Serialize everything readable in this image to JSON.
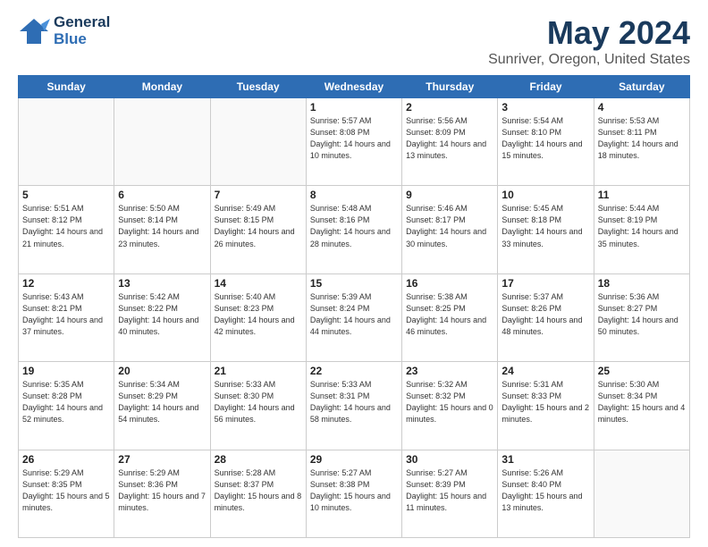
{
  "logo": {
    "line1": "General",
    "line2": "Blue"
  },
  "title": "May 2024",
  "subtitle": "Sunriver, Oregon, United States",
  "weekdays": [
    "Sunday",
    "Monday",
    "Tuesday",
    "Wednesday",
    "Thursday",
    "Friday",
    "Saturday"
  ],
  "weeks": [
    [
      {
        "day": "",
        "info": ""
      },
      {
        "day": "",
        "info": ""
      },
      {
        "day": "",
        "info": ""
      },
      {
        "day": "1",
        "info": "Sunrise: 5:57 AM\nSunset: 8:08 PM\nDaylight: 14 hours\nand 10 minutes."
      },
      {
        "day": "2",
        "info": "Sunrise: 5:56 AM\nSunset: 8:09 PM\nDaylight: 14 hours\nand 13 minutes."
      },
      {
        "day": "3",
        "info": "Sunrise: 5:54 AM\nSunset: 8:10 PM\nDaylight: 14 hours\nand 15 minutes."
      },
      {
        "day": "4",
        "info": "Sunrise: 5:53 AM\nSunset: 8:11 PM\nDaylight: 14 hours\nand 18 minutes."
      }
    ],
    [
      {
        "day": "5",
        "info": "Sunrise: 5:51 AM\nSunset: 8:12 PM\nDaylight: 14 hours\nand 21 minutes."
      },
      {
        "day": "6",
        "info": "Sunrise: 5:50 AM\nSunset: 8:14 PM\nDaylight: 14 hours\nand 23 minutes."
      },
      {
        "day": "7",
        "info": "Sunrise: 5:49 AM\nSunset: 8:15 PM\nDaylight: 14 hours\nand 26 minutes."
      },
      {
        "day": "8",
        "info": "Sunrise: 5:48 AM\nSunset: 8:16 PM\nDaylight: 14 hours\nand 28 minutes."
      },
      {
        "day": "9",
        "info": "Sunrise: 5:46 AM\nSunset: 8:17 PM\nDaylight: 14 hours\nand 30 minutes."
      },
      {
        "day": "10",
        "info": "Sunrise: 5:45 AM\nSunset: 8:18 PM\nDaylight: 14 hours\nand 33 minutes."
      },
      {
        "day": "11",
        "info": "Sunrise: 5:44 AM\nSunset: 8:19 PM\nDaylight: 14 hours\nand 35 minutes."
      }
    ],
    [
      {
        "day": "12",
        "info": "Sunrise: 5:43 AM\nSunset: 8:21 PM\nDaylight: 14 hours\nand 37 minutes."
      },
      {
        "day": "13",
        "info": "Sunrise: 5:42 AM\nSunset: 8:22 PM\nDaylight: 14 hours\nand 40 minutes."
      },
      {
        "day": "14",
        "info": "Sunrise: 5:40 AM\nSunset: 8:23 PM\nDaylight: 14 hours\nand 42 minutes."
      },
      {
        "day": "15",
        "info": "Sunrise: 5:39 AM\nSunset: 8:24 PM\nDaylight: 14 hours\nand 44 minutes."
      },
      {
        "day": "16",
        "info": "Sunrise: 5:38 AM\nSunset: 8:25 PM\nDaylight: 14 hours\nand 46 minutes."
      },
      {
        "day": "17",
        "info": "Sunrise: 5:37 AM\nSunset: 8:26 PM\nDaylight: 14 hours\nand 48 minutes."
      },
      {
        "day": "18",
        "info": "Sunrise: 5:36 AM\nSunset: 8:27 PM\nDaylight: 14 hours\nand 50 minutes."
      }
    ],
    [
      {
        "day": "19",
        "info": "Sunrise: 5:35 AM\nSunset: 8:28 PM\nDaylight: 14 hours\nand 52 minutes."
      },
      {
        "day": "20",
        "info": "Sunrise: 5:34 AM\nSunset: 8:29 PM\nDaylight: 14 hours\nand 54 minutes."
      },
      {
        "day": "21",
        "info": "Sunrise: 5:33 AM\nSunset: 8:30 PM\nDaylight: 14 hours\nand 56 minutes."
      },
      {
        "day": "22",
        "info": "Sunrise: 5:33 AM\nSunset: 8:31 PM\nDaylight: 14 hours\nand 58 minutes."
      },
      {
        "day": "23",
        "info": "Sunrise: 5:32 AM\nSunset: 8:32 PM\nDaylight: 15 hours\nand 0 minutes."
      },
      {
        "day": "24",
        "info": "Sunrise: 5:31 AM\nSunset: 8:33 PM\nDaylight: 15 hours\nand 2 minutes."
      },
      {
        "day": "25",
        "info": "Sunrise: 5:30 AM\nSunset: 8:34 PM\nDaylight: 15 hours\nand 4 minutes."
      }
    ],
    [
      {
        "day": "26",
        "info": "Sunrise: 5:29 AM\nSunset: 8:35 PM\nDaylight: 15 hours\nand 5 minutes."
      },
      {
        "day": "27",
        "info": "Sunrise: 5:29 AM\nSunset: 8:36 PM\nDaylight: 15 hours\nand 7 minutes."
      },
      {
        "day": "28",
        "info": "Sunrise: 5:28 AM\nSunset: 8:37 PM\nDaylight: 15 hours\nand 8 minutes."
      },
      {
        "day": "29",
        "info": "Sunrise: 5:27 AM\nSunset: 8:38 PM\nDaylight: 15 hours\nand 10 minutes."
      },
      {
        "day": "30",
        "info": "Sunrise: 5:27 AM\nSunset: 8:39 PM\nDaylight: 15 hours\nand 11 minutes."
      },
      {
        "day": "31",
        "info": "Sunrise: 5:26 AM\nSunset: 8:40 PM\nDaylight: 15 hours\nand 13 minutes."
      },
      {
        "day": "",
        "info": ""
      }
    ]
  ]
}
